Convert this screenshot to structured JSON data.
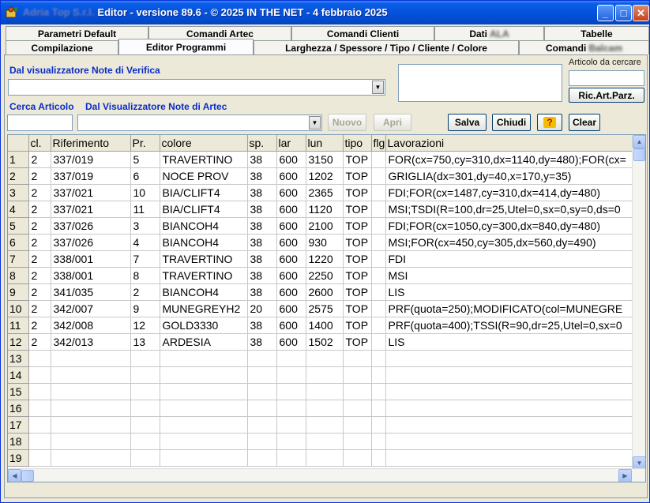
{
  "window": {
    "title_blurred": "Adria Top S.r.l.",
    "title": "Editor - versione 89.6 - © 2025  IN THE NET - 4 febbraio 2025",
    "minimize": "_",
    "maximize": "□",
    "close": "✕"
  },
  "tabs_row1": [
    {
      "label": "Parametri Default"
    },
    {
      "label": "Comandi Artec"
    },
    {
      "label": "Comandi Clienti"
    },
    {
      "label": "Dati",
      "blurred": "ALA"
    },
    {
      "label": "Tabelle"
    }
  ],
  "tabs_row2": [
    {
      "label": "Compilazione"
    },
    {
      "label": "Editor Programmi"
    },
    {
      "label": "Larghezza / Spessore / Tipo / Cliente / Colore"
    },
    {
      "label": "Comandi",
      "blurred": "Balcam"
    }
  ],
  "labels": {
    "dal_visualizzatore": "Dal visualizzatore Note di Verifica",
    "articolo_da_cercare": "Articolo da cercare",
    "cerca_articolo": "Cerca Articolo",
    "dal_visualizzatore_artec": "Dal Visualizzatore Note di  Artec"
  },
  "inputs": {
    "note_verifica": "",
    "articolo_cercare": "",
    "cerca_articolo": "",
    "note_artec": "",
    "note_box": ""
  },
  "buttons": {
    "ric_art_parz": "Ric.Art.Parz.",
    "nuovo": "Nuovo",
    "apri": "Apri",
    "salva": "Salva",
    "chiudi": "Chiudi",
    "help": "?",
    "clear": "Clear"
  },
  "table": {
    "columns": [
      "",
      "cl.",
      "Riferimento",
      "Pr.",
      "colore",
      "sp.",
      "lar",
      "lun",
      "tipo",
      "flg",
      "Lavorazioni"
    ],
    "rows": [
      [
        "1",
        "2",
        "337/019",
        "5",
        "TRAVERTINO",
        "38",
        "600",
        "3150",
        "TOP",
        "",
        "FOR(cx=750,cy=310,dx=1140,dy=480);FOR(cx="
      ],
      [
        "2",
        "2",
        "337/019",
        "6",
        "NOCE PROV",
        "38",
        "600",
        "1202",
        "TOP",
        "",
        "GRIGLIA(dx=301,dy=40,x=170,y=35)"
      ],
      [
        "3",
        "2",
        "337/021",
        "10",
        "BIA/CLIFT4",
        "38",
        "600",
        "2365",
        "TOP",
        "",
        "FDI;FOR(cx=1487,cy=310,dx=414,dy=480)"
      ],
      [
        "4",
        "2",
        "337/021",
        "11",
        "BIA/CLIFT4",
        "38",
        "600",
        "1120",
        "TOP",
        "",
        "MSI;TSDI(R=100,dr=25,Utel=0,sx=0,sy=0,ds=0"
      ],
      [
        "5",
        "2",
        "337/026",
        "3",
        "BIANCOH4",
        "38",
        "600",
        "2100",
        "TOP",
        "",
        "FDI;FOR(cx=1050,cy=300,dx=840,dy=480)"
      ],
      [
        "6",
        "2",
        "337/026",
        "4",
        "BIANCOH4",
        "38",
        "600",
        "930",
        "TOP",
        "",
        "MSI;FOR(cx=450,cy=305,dx=560,dy=490)"
      ],
      [
        "7",
        "2",
        "338/001",
        "7",
        "TRAVERTINO",
        "38",
        "600",
        "1220",
        "TOP",
        "",
        "FDI"
      ],
      [
        "8",
        "2",
        "338/001",
        "8",
        "TRAVERTINO",
        "38",
        "600",
        "2250",
        "TOP",
        "",
        "MSI"
      ],
      [
        "9",
        "2",
        "341/035",
        "2",
        "BIANCOH4",
        "38",
        "600",
        "2600",
        "TOP",
        "",
        "LIS"
      ],
      [
        "10",
        "2",
        "342/007",
        "9",
        "MUNEGREYH2",
        "20",
        "600",
        "2575",
        "TOP",
        "",
        "PRF(quota=250);MODIFICATO(col=MUNEGRE"
      ],
      [
        "11",
        "2",
        "342/008",
        "12",
        "GOLD3330",
        "38",
        "600",
        "1400",
        "TOP",
        "",
        "PRF(quota=400);TSSI(R=90,dr=25,Utel=0,sx=0"
      ],
      [
        "12",
        "2",
        "342/013",
        "13",
        "ARDESIA",
        "38",
        "600",
        "1502",
        "TOP",
        "",
        "LIS"
      ],
      [
        "13",
        "",
        "",
        "",
        "",
        "",
        "",
        "",
        "",
        "",
        ""
      ],
      [
        "14",
        "",
        "",
        "",
        "",
        "",
        "",
        "",
        "",
        "",
        ""
      ],
      [
        "15",
        "",
        "",
        "",
        "",
        "",
        "",
        "",
        "",
        "",
        ""
      ],
      [
        "16",
        "",
        "",
        "",
        "",
        "",
        "",
        "",
        "",
        "",
        ""
      ],
      [
        "17",
        "",
        "",
        "",
        "",
        "",
        "",
        "",
        "",
        "",
        ""
      ],
      [
        "18",
        "",
        "",
        "",
        "",
        "",
        "",
        "",
        "",
        "",
        ""
      ],
      [
        "19",
        "",
        "",
        "",
        "",
        "",
        "",
        "",
        "",
        "",
        ""
      ]
    ]
  }
}
